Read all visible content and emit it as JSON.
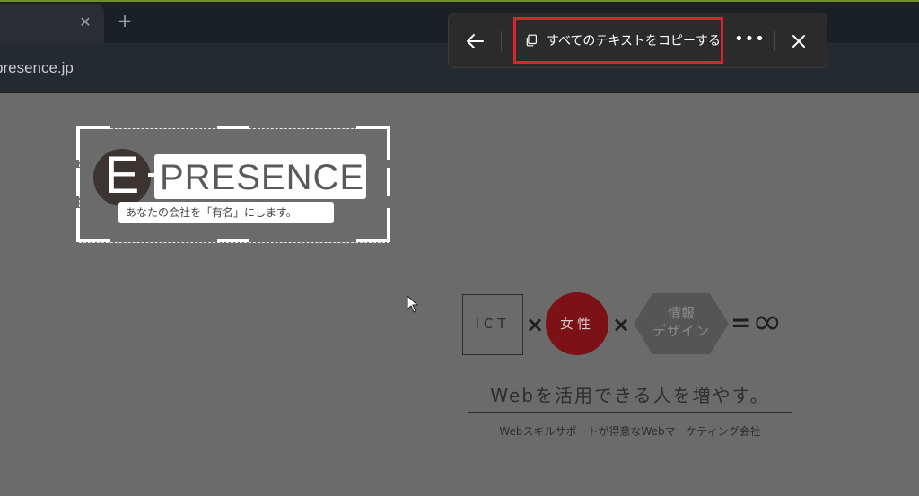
{
  "browser": {
    "tab_close_glyph": "✕",
    "new_tab_glyph": "+",
    "url_fragment": "presence.jp"
  },
  "toolbar": {
    "back_icon": "arrow-left-icon",
    "copy_icon": "copy-icon",
    "copy_label": "すべてのテキストをコピーする",
    "more_glyph": "•••",
    "close_icon": "close-icon",
    "highlight_color": "#e0202a"
  },
  "logo": {
    "letter": "E",
    "word": "PRESENCE",
    "tagline": "あなたの会社を「有名」にします。"
  },
  "formula": {
    "ict": "ICT",
    "times": "×",
    "woman": "女性",
    "info_line1": "情報",
    "info_line2": "デザイン",
    "equals": "=",
    "infinity": "∞",
    "woman_color": "#7c1217"
  },
  "headline": "Webを活用できる人を増やす。",
  "subline": "Webスキルサポートが得意なWebマーケティング会社"
}
